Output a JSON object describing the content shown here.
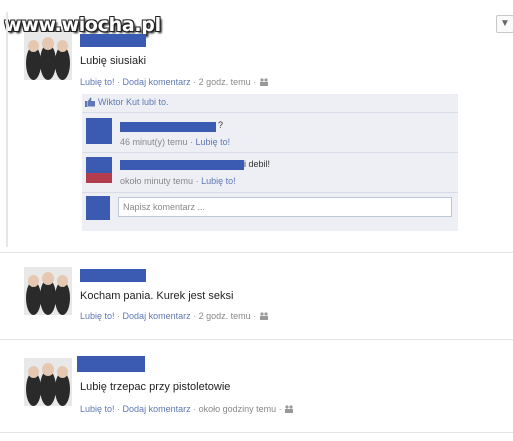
{
  "watermark": "www.wiocha.pl",
  "menu_icon": "chevron-down-icon",
  "posts": [
    {
      "text": "Lubię siusiaki",
      "actions": {
        "like": "Lubię to!",
        "comment": "Dodaj komentarz",
        "time": "2 godz. temu"
      },
      "likes_line": "Wiktor Kut lubi to.",
      "comments": [
        {
          "text": "?",
          "meta_time": "46 minut(y) temu",
          "meta_like": "Lubię to!"
        },
        {
          "text": "i debil!",
          "meta_time": "około minuty temu",
          "meta_like": "Lubię to!"
        }
      ],
      "comment_placeholder": "Napisz komentarz ..."
    },
    {
      "text": "Kocham pania. Kurek jest seksi",
      "actions": {
        "like": "Lubię to!",
        "comment": "Dodaj komentarz",
        "time": "2 godz. temu"
      }
    },
    {
      "text": "Lubię trzepac przy pistoletowie",
      "actions": {
        "like": "Lubię to!",
        "comment": "Dodaj komentarz",
        "time": "około godziny temu"
      }
    }
  ],
  "colors": {
    "link": "#5e78b5",
    "redaction": "#3b5bb3",
    "comment_bg": "#edeff4"
  }
}
